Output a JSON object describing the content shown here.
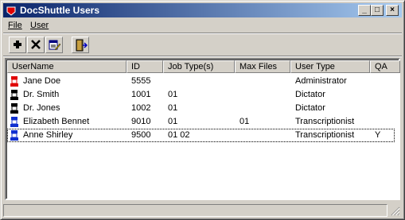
{
  "window": {
    "title": "DocShuttle Users",
    "controls": {
      "minimize": "_",
      "maximize": "□",
      "close": "×"
    }
  },
  "menu": [
    {
      "label": "File"
    },
    {
      "label": "User"
    }
  ],
  "toolbar": [
    {
      "name": "add-user-button",
      "icon": "plus-icon"
    },
    {
      "name": "delete-user-button",
      "icon": "x-delete-icon"
    },
    {
      "name": "edit-user-button",
      "icon": "edit-form-icon"
    },
    {
      "name": "exit-button",
      "icon": "exit-door-icon"
    }
  ],
  "table": {
    "columns": [
      "UserName",
      "ID",
      "Job Type(s)",
      "Max Files",
      "User Type",
      "QA"
    ],
    "rows": [
      {
        "username": "Jane Doe",
        "id": "5555",
        "job_types": "",
        "max_files": "",
        "user_type": "Administrator",
        "qa": "",
        "icon_color": "#e00000"
      },
      {
        "username": "Dr. Smith",
        "id": "1001",
        "job_types": "01",
        "max_files": "",
        "user_type": "Dictator",
        "qa": "",
        "icon_color": "#000000"
      },
      {
        "username": "Dr. Jones",
        "id": "1002",
        "job_types": "01",
        "max_files": "",
        "user_type": "Dictator",
        "qa": "",
        "icon_color": "#000000"
      },
      {
        "username": "Elizabeth Bennet",
        "id": "9010",
        "job_types": "01",
        "max_files": "01",
        "user_type": "Transcriptionist",
        "qa": "",
        "icon_color": "#1030d0"
      },
      {
        "username": "Anne Shirley",
        "id": "9500",
        "job_types": "01 02",
        "max_files": "",
        "user_type": "Transcriptionist",
        "qa": "Y",
        "icon_color": "#1030d0"
      }
    ]
  }
}
